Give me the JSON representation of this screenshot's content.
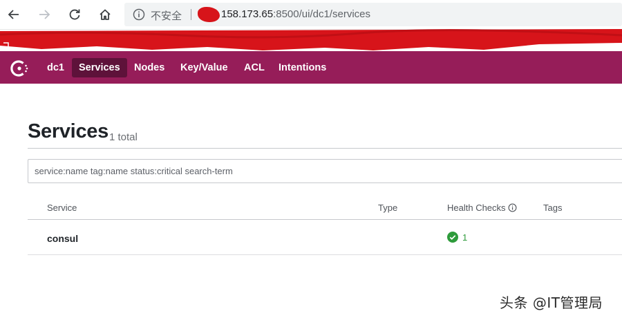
{
  "browser": {
    "security_label": "不安全",
    "url_host": "158.173.65",
    "url_rest": ":8500/ui/dc1/services"
  },
  "colors": {
    "nav_background": "#961d59",
    "nav_active": "#5e123a",
    "health_passing": "#2e9b3b",
    "redaction": "#d7141a"
  },
  "nav": {
    "datacenter": "dc1",
    "items": [
      {
        "label": "Services",
        "active": true
      },
      {
        "label": "Nodes"
      },
      {
        "label": "Key/Value"
      },
      {
        "label": "ACL"
      },
      {
        "label": "Intentions"
      }
    ]
  },
  "page": {
    "title": "Services",
    "total": "1 total",
    "search_placeholder": "service:name tag:name status:critical search-term"
  },
  "table": {
    "columns": [
      "Service",
      "Type",
      "Health Checks",
      "Tags"
    ],
    "rows": [
      {
        "service": "consul",
        "type": "",
        "health_checks": "1",
        "tags": ""
      }
    ]
  },
  "watermark": "头条 @IT管理局"
}
